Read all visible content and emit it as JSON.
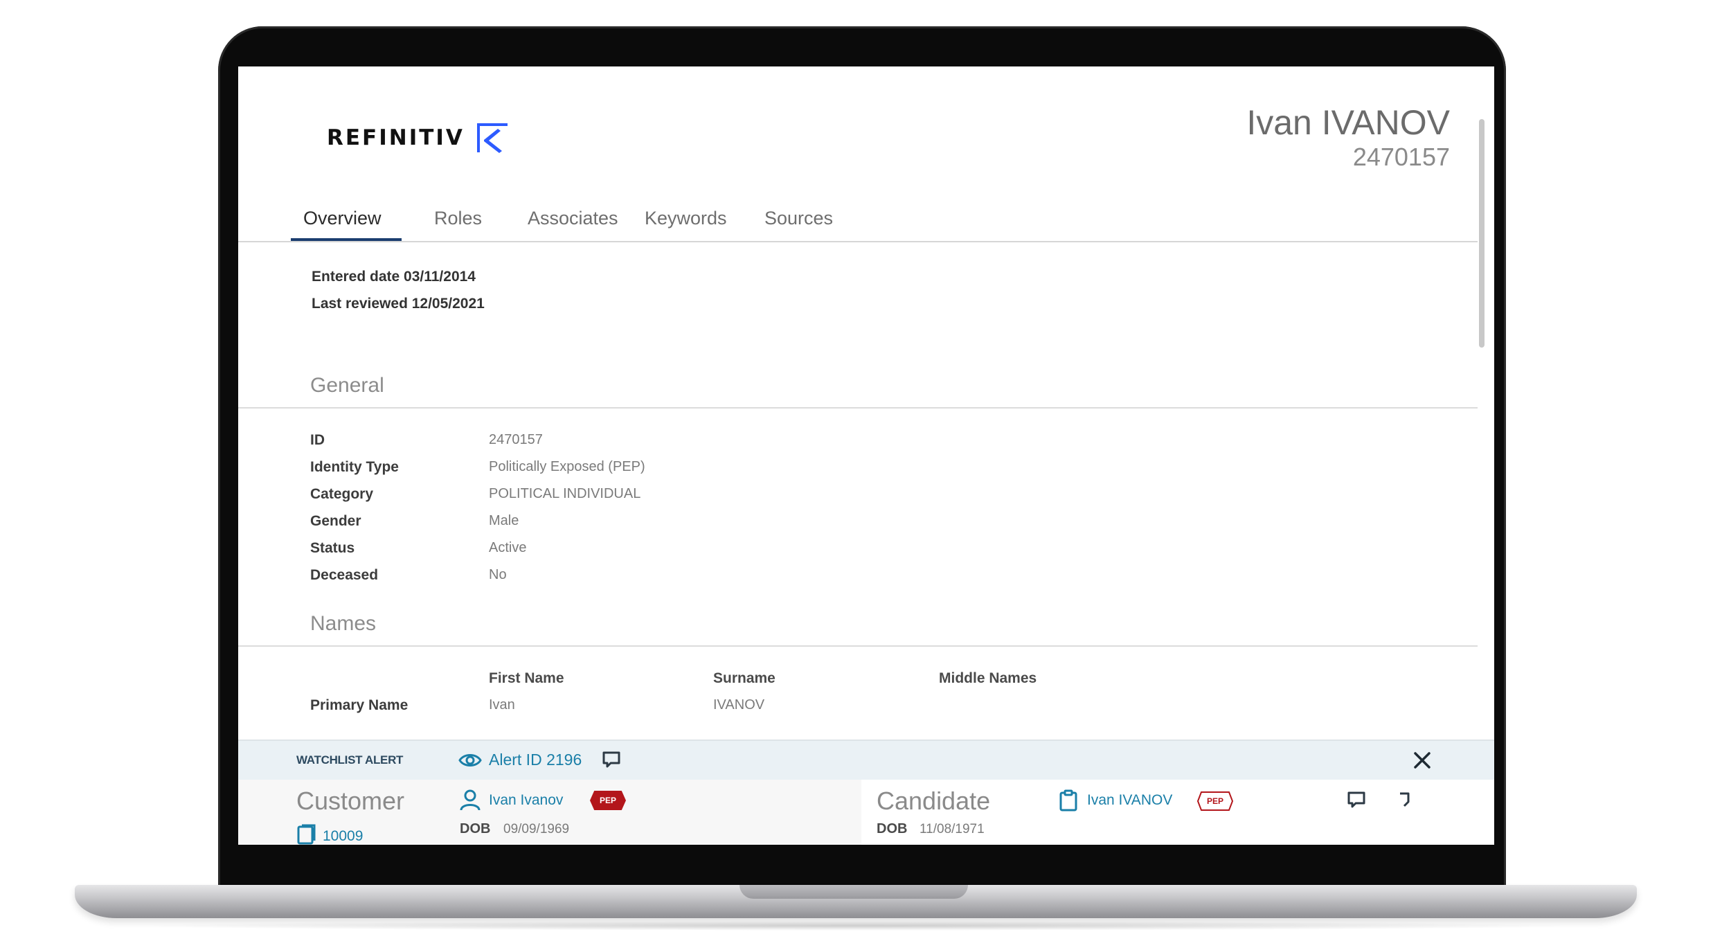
{
  "brand": {
    "name": "REFINITIV",
    "accent": "#2d5bff"
  },
  "profile": {
    "name": "Ivan IVANOV",
    "id": "2470157"
  },
  "tabs": [
    {
      "label": "Overview",
      "active": true
    },
    {
      "label": "Roles",
      "active": false
    },
    {
      "label": "Associates",
      "active": false
    },
    {
      "label": "Keywords",
      "active": false
    },
    {
      "label": "Sources",
      "active": false
    }
  ],
  "dates": {
    "entered": "Entered date 03/11/2014",
    "reviewed": "Last reviewed 12/05/2021"
  },
  "general": {
    "title": "General",
    "fields": [
      {
        "label": "ID",
        "value": "2470157"
      },
      {
        "label": "Identity Type",
        "value": "Politically Exposed (PEP)"
      },
      {
        "label": "Category",
        "value": "POLITICAL INDIVIDUAL"
      },
      {
        "label": "Gender",
        "value": "Male"
      },
      {
        "label": "Status",
        "value": "Active"
      },
      {
        "label": "Deceased",
        "value": "No"
      }
    ]
  },
  "names": {
    "title": "Names",
    "columns": [
      "First Name",
      "Surname",
      "Middle Names"
    ],
    "rows": [
      {
        "label": "Primary Name",
        "first": "Ivan",
        "surname": "IVANOV",
        "middle": ""
      }
    ]
  },
  "alert": {
    "label": "WATCHLIST ALERT",
    "id_text": "Alert ID 2196",
    "icons": [
      "eye-icon",
      "comment-icon",
      "close-icon"
    ],
    "link_color": "#1a7fa8"
  },
  "customer": {
    "title": "Customer",
    "name": "Ivan Ivanov",
    "badge": "PEP",
    "dob_label": "DOB",
    "dob": "09/09/1969",
    "case_id": "10009"
  },
  "candidate": {
    "title": "Candidate",
    "name": "Ivan IVANOV",
    "badge": "PEP",
    "dob_label": "DOB",
    "dob": "11/08/1971"
  },
  "colors": {
    "pep_red": "#b3161b",
    "tab_underline": "#1b3d6f"
  }
}
